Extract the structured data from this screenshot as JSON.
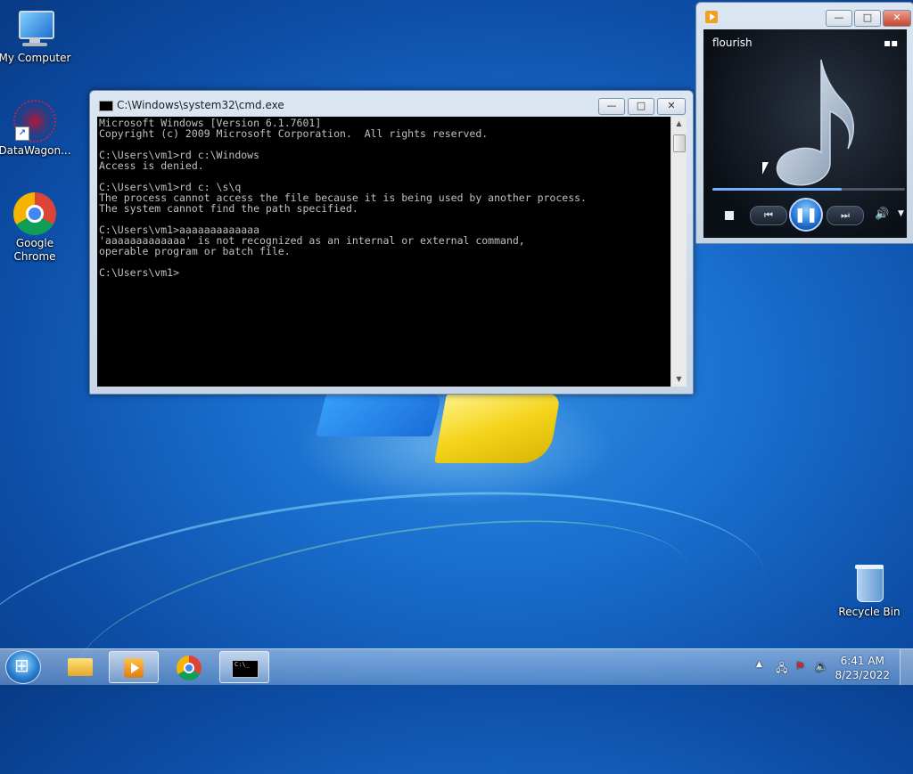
{
  "desktop": {
    "icons": [
      {
        "label": "My Computer"
      },
      {
        "label": "DataWagon..."
      },
      {
        "label": "Google Chrome"
      },
      {
        "label": "Recycle Bin"
      }
    ]
  },
  "cmd_window": {
    "title": "C:\\Windows\\system32\\cmd.exe",
    "console_text": "Microsoft Windows [Version 6.1.7601]\nCopyright (c) 2009 Microsoft Corporation.  All rights reserved.\n\nC:\\Users\\vm1>rd c:\\Windows\nAccess is denied.\n\nC:\\Users\\vm1>rd c: \\s\\q\nThe process cannot access the file because it is being used by another process.\nThe system cannot find the path specified.\n\nC:\\Users\\vm1>aaaaaaaaaaaaa\n'aaaaaaaaaaaaa' is not recognized as an internal or external command,\noperable program or batch file.\n\nC:\\Users\\vm1>",
    "buttons": {
      "minimize": "—",
      "maximize": "□",
      "close": "✕"
    }
  },
  "media_player": {
    "track_title": "flourish",
    "progress_fraction": 0.67,
    "controls": {
      "stop": "stop",
      "prev": "⏮",
      "pause": "❚❚",
      "next": "⏭",
      "volume": "🔊",
      "volume_menu": "▼"
    },
    "buttons": {
      "minimize": "—",
      "maximize": "□",
      "close": "✕"
    },
    "switch_label": "▪▪"
  },
  "taskbar": {
    "apps": [
      "Windows Explorer",
      "Windows Media Player",
      "Google Chrome",
      "Command Prompt"
    ],
    "cmd_thumb_text": "C:\\_",
    "tray": {
      "show_hidden": "▲"
    },
    "clock": {
      "time": "6:41 AM",
      "date": "8/23/2022"
    }
  },
  "colors": {
    "console_bg": "#000000",
    "console_fg": "#c0c0c0",
    "accent": "#1f6fd0"
  }
}
